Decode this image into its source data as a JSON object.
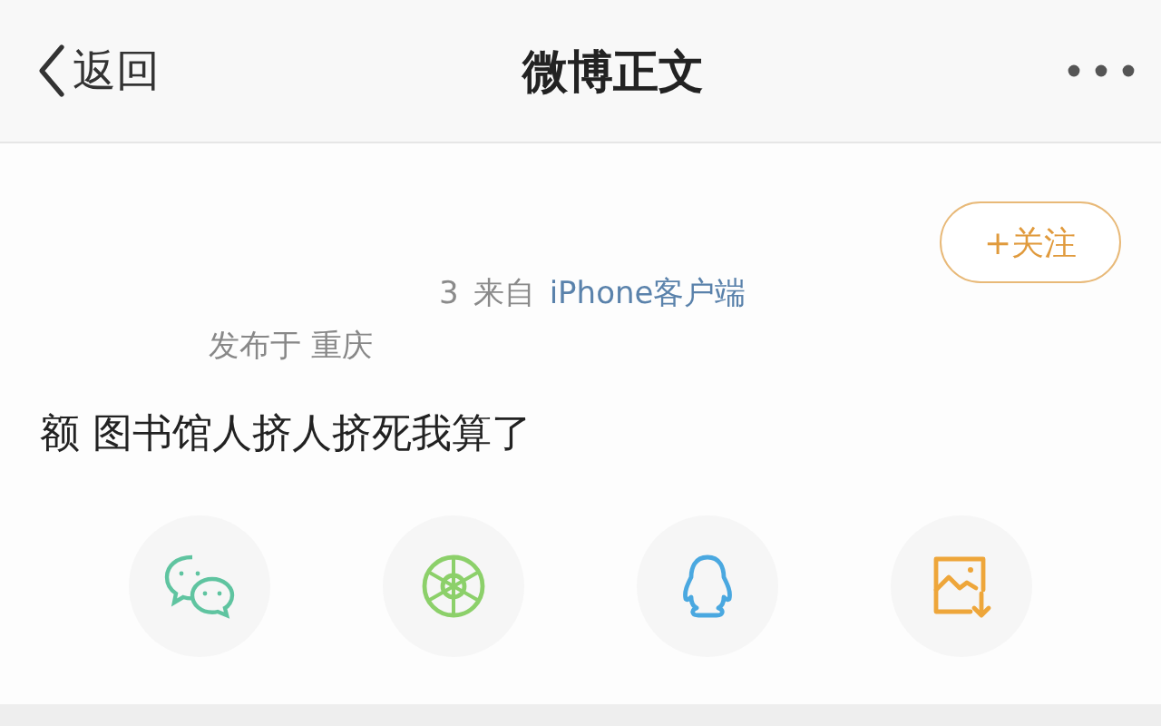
{
  "header": {
    "back_label": "返回",
    "title": "微博正文"
  },
  "post": {
    "follow_label": "+关注",
    "time_fragment": "3",
    "source_prefix": "来自",
    "source": "iPhone客户端",
    "location": "发布于 重庆",
    "text": "额 图书馆人挤人挤死我算了"
  },
  "share_targets": [
    {
      "kind": "wechat"
    },
    {
      "kind": "moments"
    },
    {
      "kind": "qq"
    },
    {
      "kind": "save-image"
    }
  ]
}
